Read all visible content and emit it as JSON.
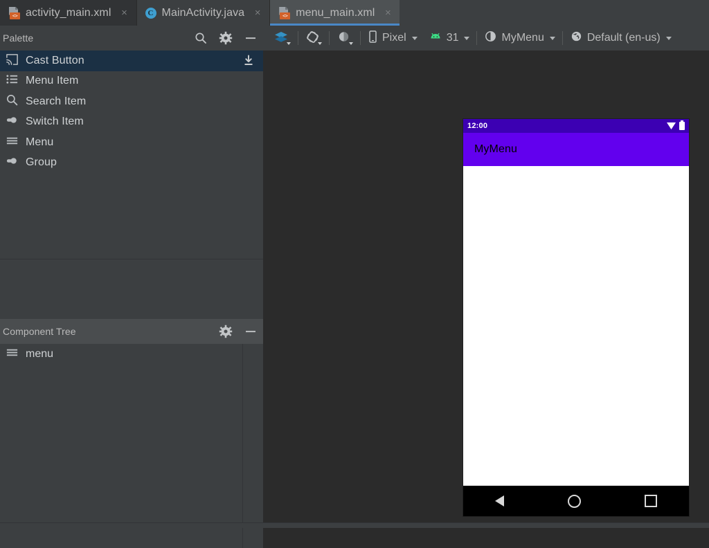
{
  "tabs": [
    {
      "label": "activity_main.xml",
      "icon": "xml-file-icon",
      "badge": "<>",
      "active": false,
      "close": "×"
    },
    {
      "label": "MainActivity.java",
      "icon": "java-file-icon",
      "badge": "C",
      "active": false,
      "close": "×"
    },
    {
      "label": "menu_main.xml",
      "icon": "xml-file-icon",
      "badge": "<>",
      "active": true,
      "close": "×"
    }
  ],
  "palette": {
    "title": "Palette",
    "actions": [
      {
        "name": "search-icon",
        "label": "Search"
      },
      {
        "name": "gear-icon",
        "label": "Palette Settings"
      },
      {
        "name": "minimize-icon",
        "label": "Hide"
      }
    ],
    "items": [
      {
        "label": "Cast Button",
        "icon": "cast-icon",
        "selected": true,
        "download": true
      },
      {
        "label": "Menu Item",
        "icon": "list-icon",
        "selected": false,
        "download": false
      },
      {
        "label": "Search Item",
        "icon": "search-icon",
        "selected": false,
        "download": false
      },
      {
        "label": "Switch Item",
        "icon": "switch-icon",
        "selected": false,
        "download": false
      },
      {
        "label": "Menu",
        "icon": "hamburger-icon",
        "selected": false,
        "download": false
      },
      {
        "label": "Group",
        "icon": "switch-icon",
        "selected": false,
        "download": false
      }
    ]
  },
  "component_tree": {
    "title": "Component Tree",
    "actions": [
      {
        "name": "gear-icon",
        "label": "Tree Settings"
      },
      {
        "name": "minimize-icon",
        "label": "Hide"
      }
    ],
    "nodes": [
      {
        "label": "menu",
        "icon": "hamburger-icon"
      }
    ]
  },
  "toolbar": {
    "design_mode": {
      "icon": "layers-icon",
      "label": ""
    },
    "orientation": {
      "icon": "rotate-icon",
      "label": ""
    },
    "theme_mode": {
      "icon": "contrast-icon",
      "label": ""
    },
    "device": {
      "icon": "phone-icon",
      "label": "Pixel"
    },
    "api_level": {
      "icon": "android-icon",
      "label": "31"
    },
    "theme": {
      "icon": "theme-icon",
      "label": "MyMenu"
    },
    "locale": {
      "icon": "globe-icon",
      "label": "Default (en-us)"
    }
  },
  "preview": {
    "status_time": "12:00",
    "status_icons": [
      "wifi-icon",
      "battery-icon"
    ],
    "app_title": "MyMenu",
    "nav_buttons": [
      "back-icon",
      "home-icon",
      "recents-icon"
    ]
  },
  "colors": {
    "accent_blue": "#4a88c7",
    "selection_blue": "#1b3044",
    "panel_bg": "#3c3f41",
    "canvas_bg": "#2b2b2b",
    "app_bar_purple": "#6200ee",
    "status_bar_purple": "#3c00b3",
    "android_green": "#3ddc84"
  }
}
